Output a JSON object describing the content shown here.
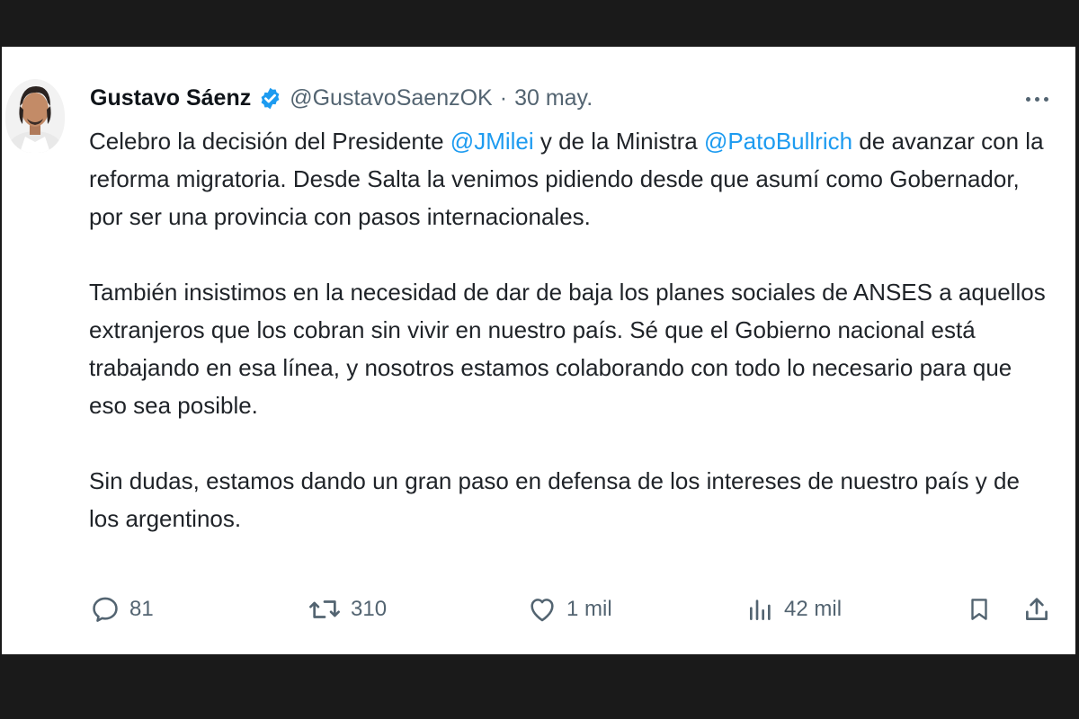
{
  "tweet": {
    "author_name": "Gustavo Sáenz",
    "handle": "@GustavoSaenzOK",
    "separator": "·",
    "date": "30 may.",
    "paragraphs": [
      {
        "parts": [
          "Celebro la decisión del Presidente ",
          "@JMilei",
          " y de la Ministra ",
          "@PatoBullrich",
          " de avanzar con la reforma migratoria. Desde Salta la venimos pidiendo desde que asumí como Gobernador, por ser una provincia con pasos internacionales."
        ]
      },
      {
        "text": "También insistimos en la necesidad de dar de baja los planes sociales de ANSES a aquellos extranjeros que los cobran sin vivir en nuestro país. Sé que el Gobierno nacional está trabajando en esa línea, y nosotros estamos colaborando con todo lo necesario para que eso sea posible."
      },
      {
        "text": "Sin dudas, estamos dando un gran paso en defensa de los intereses de nuestro país y de los argentinos."
      }
    ],
    "metrics": {
      "replies": "81",
      "retweets": "310",
      "likes": "1 mil",
      "views": "42 mil"
    }
  },
  "icons": {
    "verified": "verified-badge-icon",
    "more": "more-options-icon",
    "reply": "reply-icon",
    "retweet": "retweet-icon",
    "like": "heart-icon",
    "views": "views-chart-icon",
    "bookmark": "bookmark-icon",
    "share": "share-icon"
  },
  "colors": {
    "mention": "#1d9bf0",
    "verified": "#1d9bf0",
    "text": "#1f2328",
    "muted": "#536471",
    "background_frame": "#1a1a1a",
    "card": "#ffffff"
  }
}
